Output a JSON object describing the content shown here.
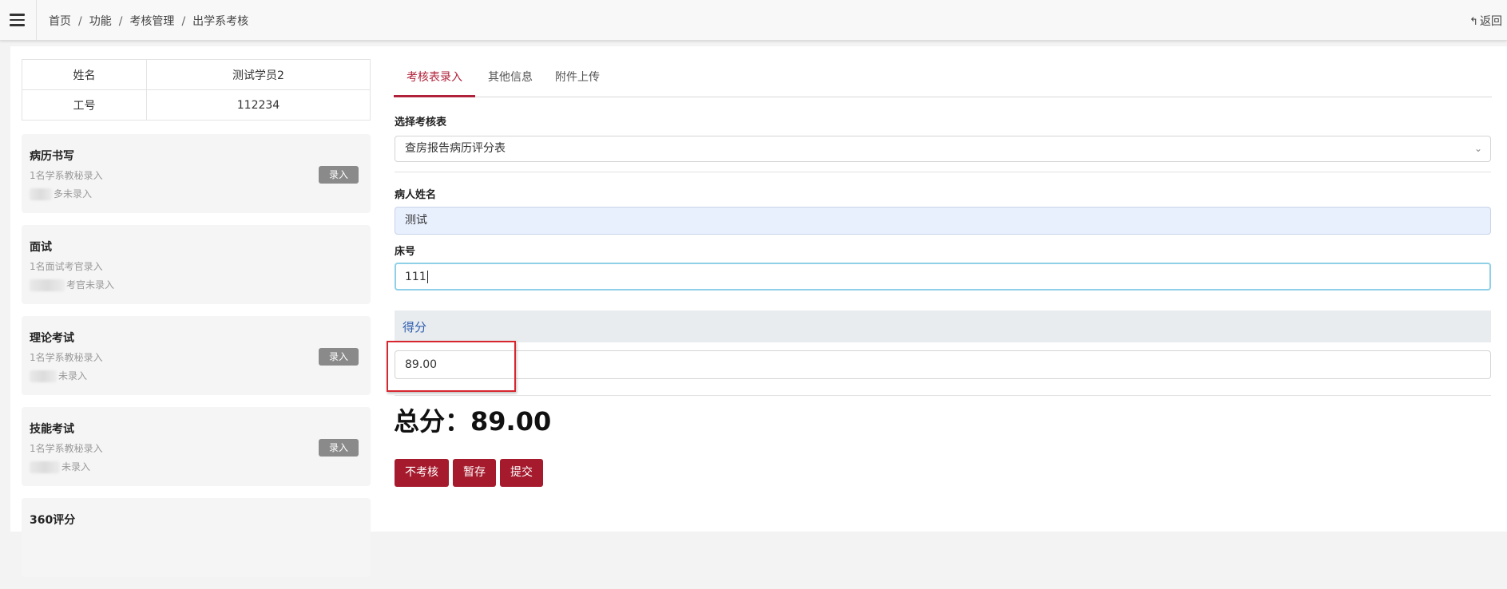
{
  "header": {
    "breadcrumb": [
      "首页",
      "功能",
      "考核管理",
      "出学系考核"
    ],
    "separator": "/",
    "back_label": "返回",
    "back_icon": "reply-arrow-icon"
  },
  "student": {
    "name_label": "姓名",
    "name_value": "测试学员2",
    "id_label": "工号",
    "id_value": "112234"
  },
  "cards": [
    {
      "title": "病历书写",
      "line1": "1名学系教秘录入",
      "line2": "多未录入",
      "button": "录入"
    },
    {
      "title": "面试",
      "line1": "1名面试考官录入",
      "line2": "考官未录入",
      "button": ""
    },
    {
      "title": "理论考试",
      "line1": "1名学系教秘录入",
      "line2": "未录入",
      "button": "录入"
    },
    {
      "title": "技能考试",
      "line1": "1名学系教秘录入",
      "line2": "未录入",
      "button": "录入"
    },
    {
      "title": "360评分",
      "line1": "",
      "line2": "",
      "button": ""
    }
  ],
  "tabs": [
    "考核表录入",
    "其他信息",
    "附件上传"
  ],
  "form": {
    "select_label": "选择考核表",
    "select_value": "查房报告病历评分表",
    "patient_label": "病人姓名",
    "patient_value": "测试",
    "bed_label": "床号",
    "bed_value": "111",
    "score_section": "得分",
    "score_value": "89.00",
    "total_label": "总分：",
    "total_value": "89.00"
  },
  "actions": {
    "skip": "不考核",
    "save": "暂存",
    "submit": "提交"
  },
  "colors": {
    "accent": "#a51b2d",
    "highlight_box": "#d8262e",
    "section_title": "#2f5fb0"
  }
}
